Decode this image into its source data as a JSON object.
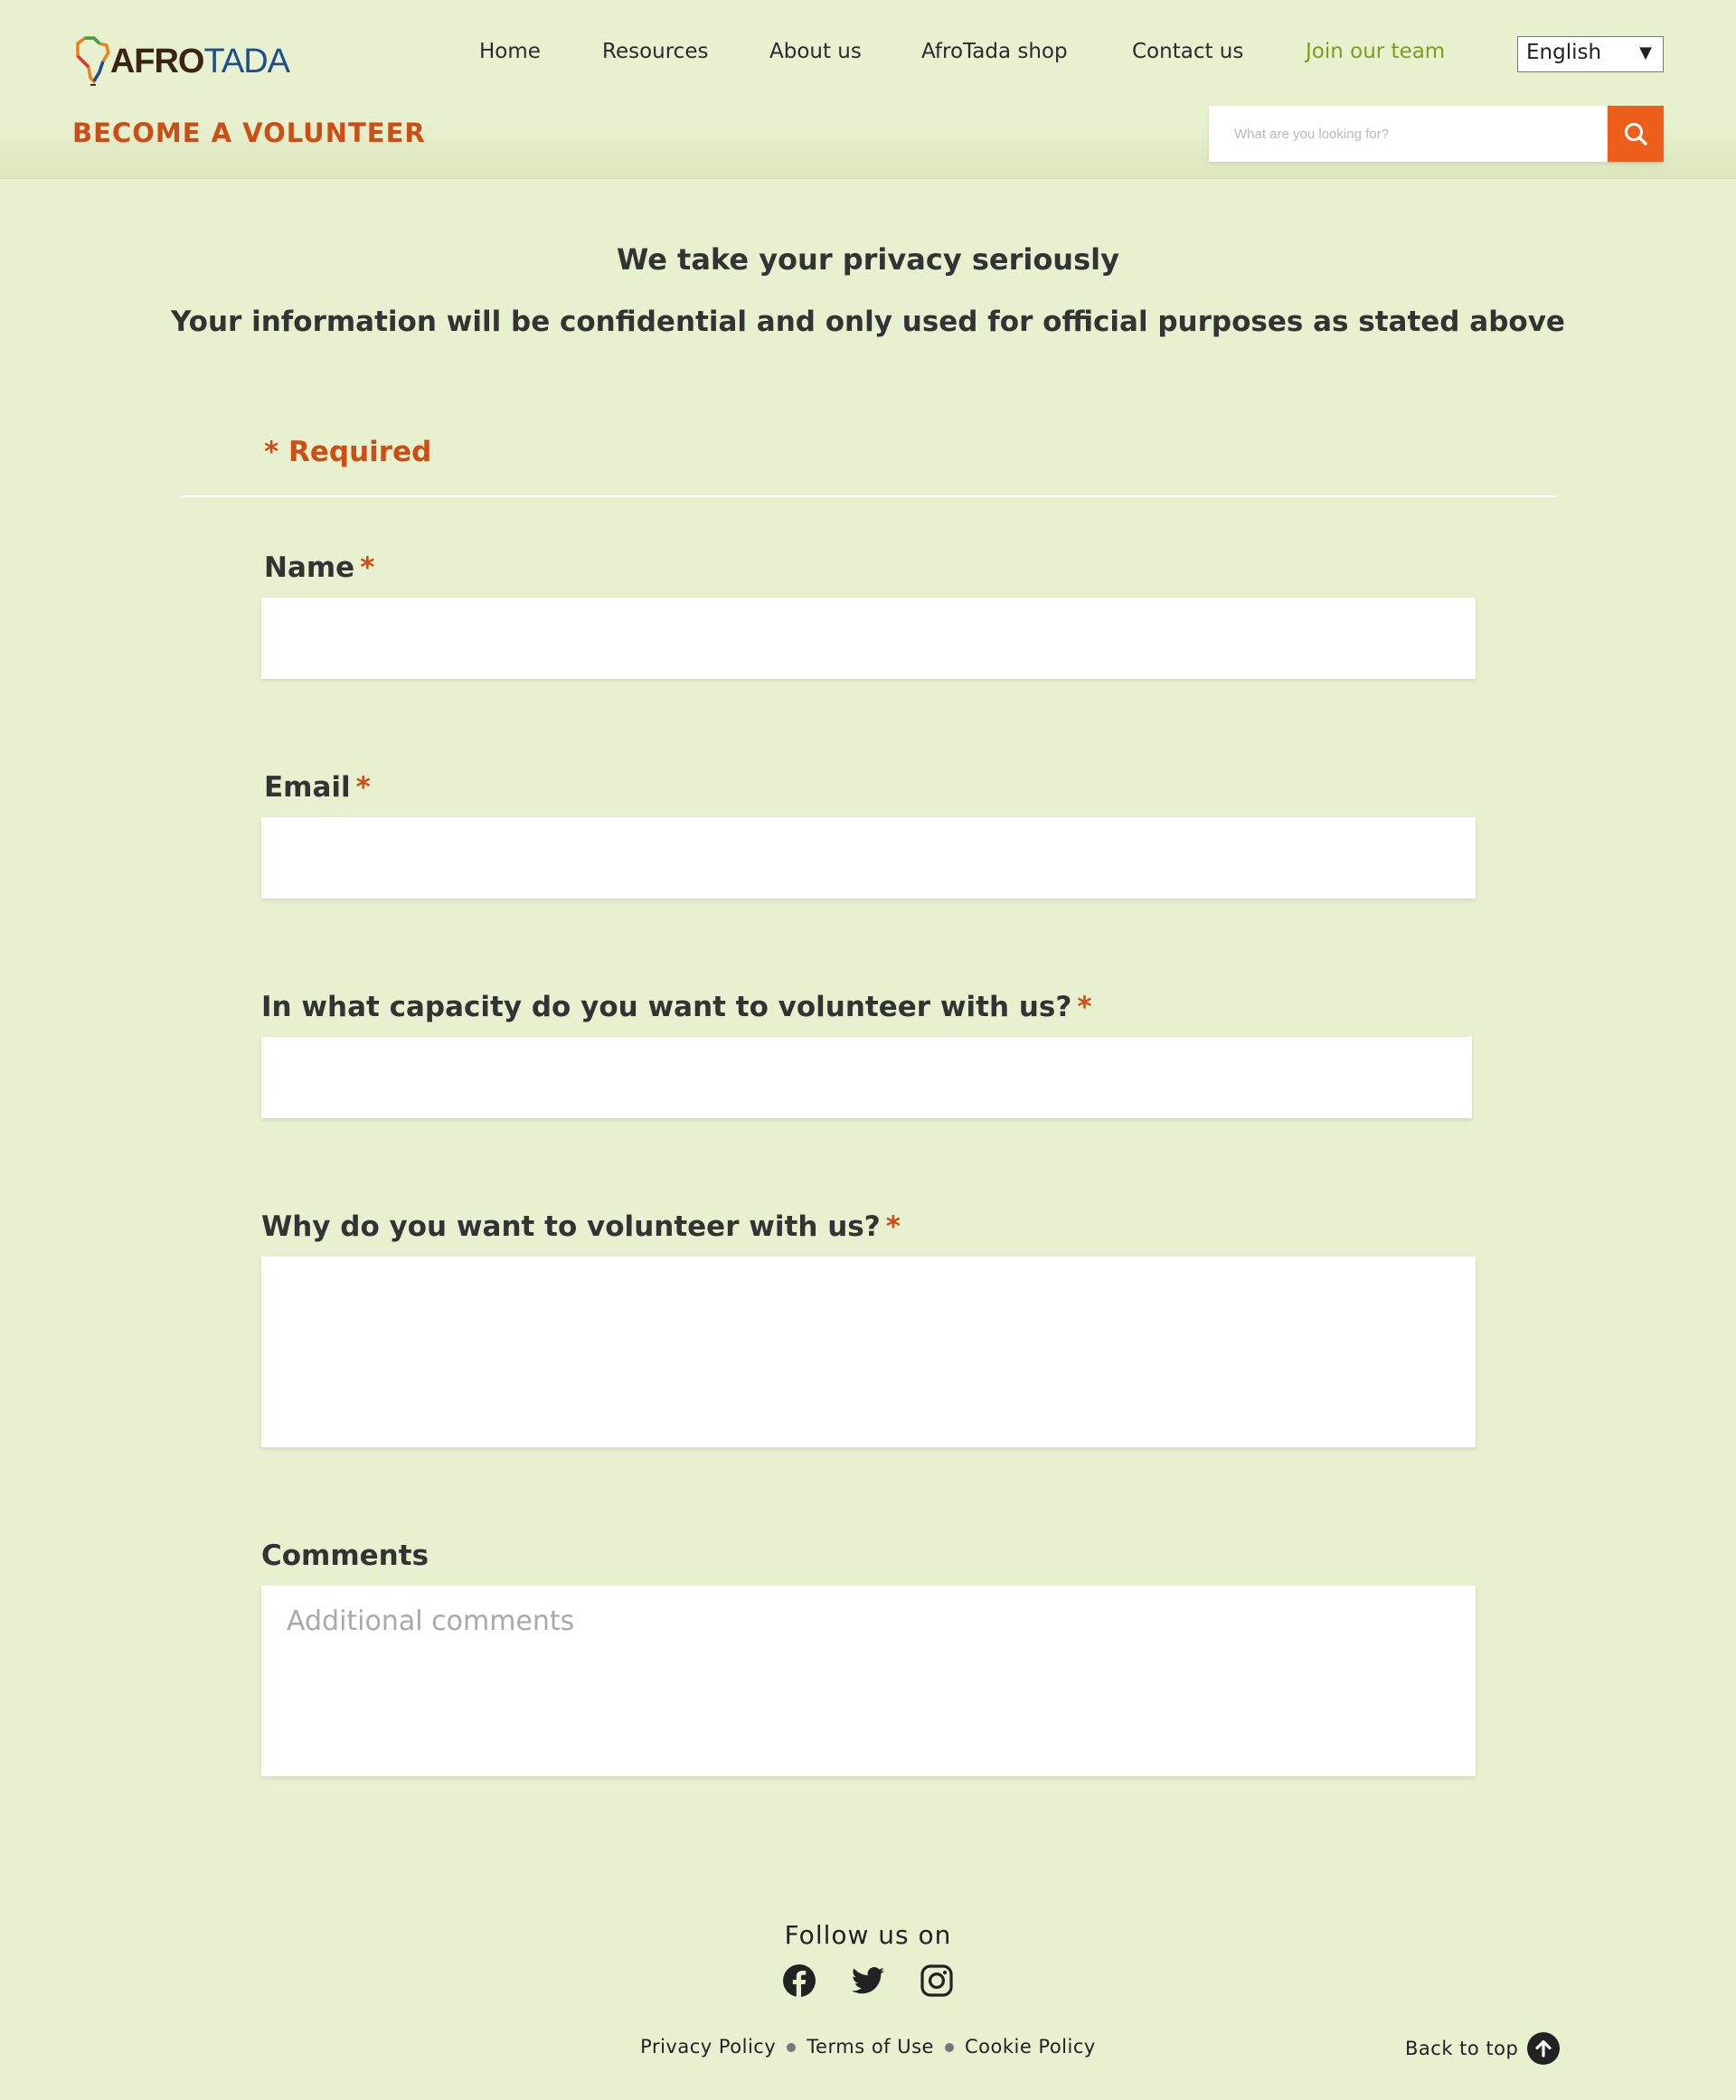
{
  "header": {
    "logo": {
      "afro": "AFRO",
      "tada": "TADA"
    },
    "nav": [
      {
        "label": "Home"
      },
      {
        "label": "Resources"
      },
      {
        "label": "About us"
      },
      {
        "label": "AfroTada shop"
      },
      {
        "label": "Contact us"
      },
      {
        "label": "Join our team",
        "active": true
      }
    ],
    "language": {
      "selected": "English"
    },
    "page_title": "BECOME A VOLUNTEER",
    "search": {
      "placeholder": "What are you looking for?",
      "icon": "search-icon"
    }
  },
  "privacy": {
    "line1": "We take your privacy seriously",
    "line2": "Your information will be confidential and only used for official purposes as stated above"
  },
  "form": {
    "required_note": "* Required",
    "required_star": "*",
    "fields": [
      {
        "label": "Name",
        "required": true,
        "value": ""
      },
      {
        "label": "Email",
        "required": true,
        "value": ""
      },
      {
        "label": "In what capacity do you want to volunteer with us?",
        "required": true,
        "value": ""
      },
      {
        "label": "Why do you want to volunteer with us?",
        "required": true,
        "value": ""
      },
      {
        "label": "Comments",
        "required": false,
        "value": "",
        "placeholder": "Additional comments"
      }
    ]
  },
  "footer": {
    "follow": "Follow us on",
    "social": [
      "facebook-icon",
      "twitter-icon",
      "instagram-icon"
    ],
    "links": [
      "Privacy Policy",
      "Terms of Use",
      "Cookie Policy"
    ],
    "back_to_top": "Back to top"
  },
  "colors": {
    "background": "#e7f0cf",
    "accent_orange": "#cc4e14",
    "search_button": "#ee5f1b",
    "active_nav": "#7e9d1c",
    "logo_blue": "#1d4f8f",
    "logo_brown": "#3b2412"
  }
}
